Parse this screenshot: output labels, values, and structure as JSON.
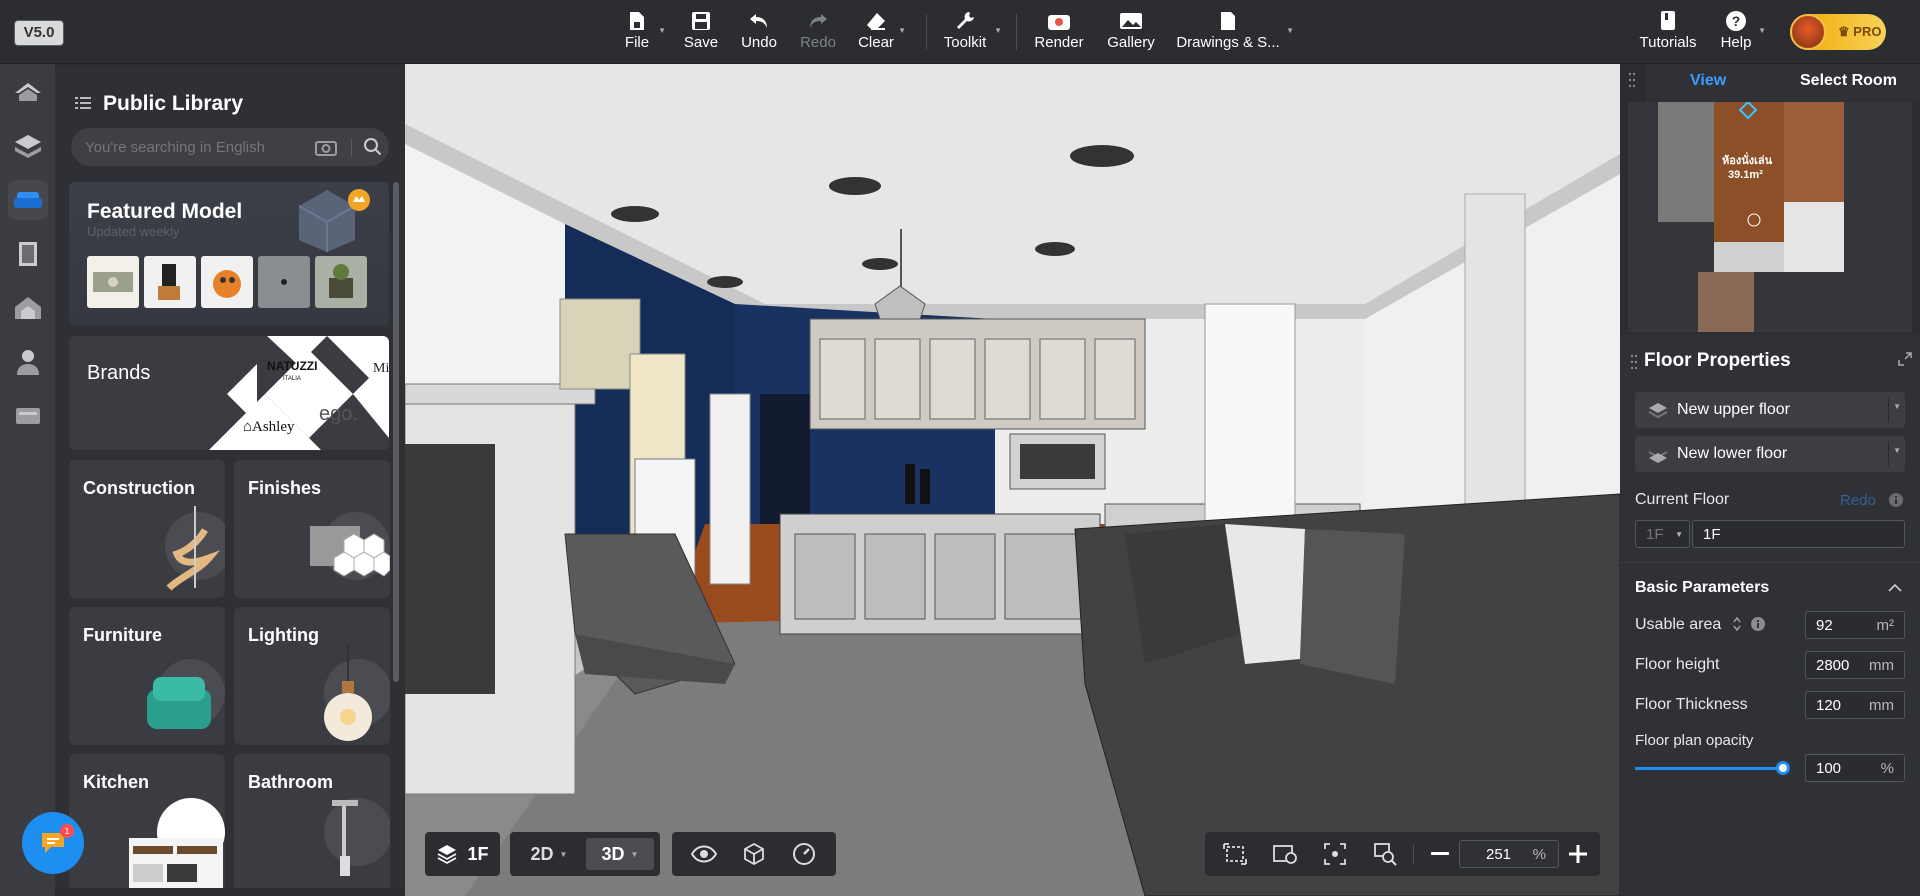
{
  "app": {
    "version": "V5.0"
  },
  "toolbar": {
    "file": "File",
    "save": "Save",
    "undo": "Undo",
    "redo": "Redo",
    "clear": "Clear",
    "toolkit": "Toolkit",
    "render": "Render",
    "gallery": "Gallery",
    "drawings": "Drawings & S...",
    "tutorials": "Tutorials",
    "help": "Help",
    "pro": "PRO"
  },
  "library": {
    "title": "Public Library",
    "search_placeholder": "You're searching in English",
    "featured": {
      "title": "Featured Model",
      "subtitle": "Updated weekly"
    },
    "brands": {
      "title": "Brands",
      "logos": [
        "NATUZZI",
        "ITALIA",
        "Ashley",
        "ego.",
        "Mi"
      ]
    },
    "categories": [
      "Construction",
      "Finishes",
      "Furniture",
      "Lighting",
      "Kitchen",
      "Bathroom"
    ]
  },
  "right_panel": {
    "tabs": [
      "View",
      "Select Room"
    ],
    "map_label": {
      "name": "ห้องนั่งเล่น",
      "area": "39.1m²"
    },
    "floor_properties": {
      "title": "Floor Properties",
      "new_upper": "New upper floor",
      "new_lower": "New lower floor",
      "current_floor_label": "Current Floor",
      "redo": "Redo",
      "floor_select": "1F",
      "floor_name": "1F",
      "basic_parameters": "Basic Parameters",
      "usable_area": {
        "label": "Usable area",
        "value": "92",
        "unit": "m²"
      },
      "floor_height": {
        "label": "Floor height",
        "value": "2800",
        "unit": "mm"
      },
      "floor_thickness": {
        "label": "Floor Thickness",
        "value": "120",
        "unit": "mm"
      },
      "floor_opacity": {
        "label": "Floor plan opacity",
        "value": "100",
        "unit": "%",
        "level": 1.0
      }
    }
  },
  "bottom": {
    "floor": "1F",
    "mode_2d": "2D",
    "mode_3d": "3D",
    "zoom_value": "251",
    "zoom_unit": "%"
  },
  "chat": {
    "badge": "1"
  },
  "colors": {
    "accent": "#1e8ff0",
    "wall_blue": "#152c57",
    "floor_wood": "#9a4b1e",
    "pro_gold": "#f0b429"
  }
}
